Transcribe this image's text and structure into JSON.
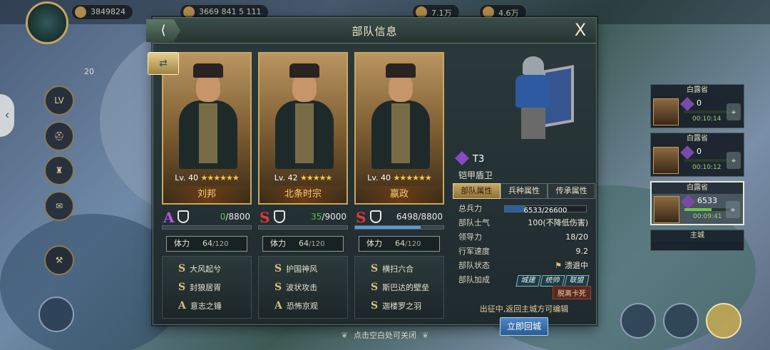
{
  "hud": {
    "power": "3849824",
    "resource_1": "3669 841 5 111",
    "resource_2": "7.1万",
    "resource_3": "4.6万",
    "level_label": "LV",
    "side_number": "20"
  },
  "dialog": {
    "title": "部队信息",
    "close": "X"
  },
  "heroes": [
    {
      "level": "Lv. 40",
      "stars": "★★★★★★",
      "name": "刘邦",
      "grade": "A",
      "troop_current": "0",
      "troop_max": "/8800",
      "troop_ratio": 0.0,
      "stamina_label": "体力",
      "stamina_value": "64",
      "stamina_max": "/120",
      "skills": [
        {
          "grade": "S",
          "name": "大风起兮"
        },
        {
          "grade": "S",
          "name": "封狼居胥"
        },
        {
          "grade": "A",
          "name": "意志之锤"
        }
      ]
    },
    {
      "level": "Lv. 42",
      "stars": "★★★★★",
      "name": "北条时宗",
      "grade": "S",
      "troop_current": "35",
      "troop_max": "/9000",
      "troop_ratio": 0.004,
      "stamina_label": "体力",
      "stamina_value": "64",
      "stamina_max": "/120",
      "skills": [
        {
          "grade": "S",
          "name": "护国神风"
        },
        {
          "grade": "S",
          "name": "波状攻击"
        },
        {
          "grade": "A",
          "name": "恐怖京观"
        }
      ]
    },
    {
      "level": "Lv. 40",
      "stars": "★★★★★★",
      "name": "嬴政",
      "grade": "S",
      "troop_current": "6498",
      "troop_max": "/8800",
      "troop_ratio": 0.738,
      "stamina_label": "体力",
      "stamina_value": "64",
      "stamina_max": "/120",
      "skills": [
        {
          "grade": "S",
          "name": "横扫六合"
        },
        {
          "grade": "S",
          "name": "斯巴达的壁垒"
        },
        {
          "grade": "S",
          "name": "迦楼罗之羽"
        }
      ]
    }
  ],
  "unit": {
    "tier": "T3",
    "name": "铠甲盾卫",
    "tabs": [
      "部队属性",
      "兵种属性",
      "传承属性"
    ],
    "stats": {
      "troops_label": "总兵力",
      "troops_value": "6533/26600",
      "troops_ratio": 0.2456,
      "morale_label": "部队士气",
      "morale_value": "100(不降低伤害)",
      "leadership_label": "领导力",
      "leadership_value": "18/20",
      "speed_label": "行军速度",
      "speed_value": "9.2",
      "status_label": "部队状态",
      "status_value": "溃退中",
      "bonus_label": "部队加成",
      "bonus_tags": [
        "城建",
        "统帅",
        "联盟"
      ]
    },
    "badge": "脱离卡死",
    "note": "出征中,返回主城方可编辑",
    "return_button": "立即回城"
  },
  "march_queue": [
    {
      "location": "白露省",
      "count": "0",
      "time": "00:10:14",
      "ratio": 0.0
    },
    {
      "location": "白露省",
      "count": "0",
      "time": "00:10:12",
      "ratio": 0.0
    },
    {
      "location": "白露省",
      "count": "6533",
      "time": "00:09:41",
      "ratio": 0.6
    },
    {
      "location": "主城",
      "count": "",
      "time": "",
      "ratio": 0.0
    }
  ],
  "bottom_tip": "点击空白处可关闭",
  "colors": {
    "grade_A": "#b456e0",
    "grade_S": "#e5383a",
    "accent_gold": "#c9a85c",
    "button_blue": "#2a5a94"
  }
}
